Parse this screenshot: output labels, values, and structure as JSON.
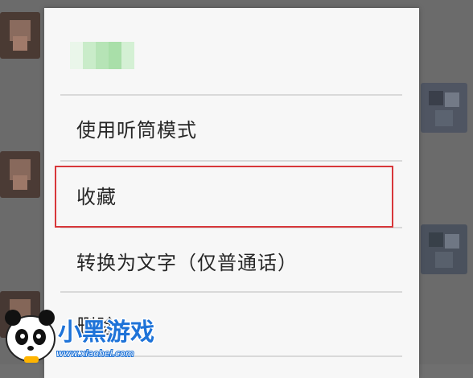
{
  "menu": {
    "items": [
      {
        "label": "使用听筒模式"
      },
      {
        "label": "收藏"
      },
      {
        "label": "转换为文字（仅普通话）"
      },
      {
        "label": "删除"
      }
    ]
  },
  "watermark": {
    "brand": "小黑游戏",
    "url": "www.xiaohei.com"
  },
  "colors": {
    "highlight": "#d8373a",
    "menu_bg": "#f7f7f7",
    "overlay": "#6b6b6b"
  }
}
